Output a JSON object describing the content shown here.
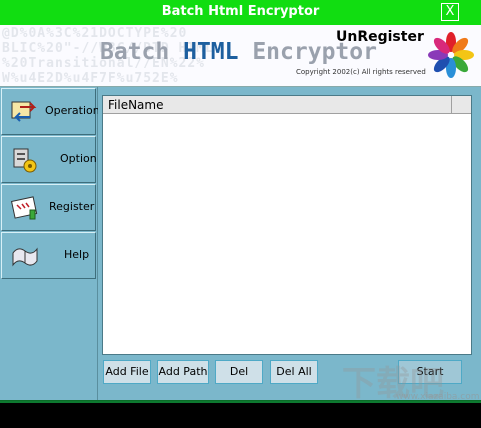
{
  "window": {
    "title": "Batch Html Encryptor",
    "close_label": "X"
  },
  "banner": {
    "watermark_lines": [
      "@D%0A%3C%21DOCTYPE%20",
      "BLIC%20\"-//W3C//DTD HTML",
      "%20Transitional//EN%22%",
      "W%u4E2D%u4F7F%u752E%"
    ],
    "brand_part1": "Batch ",
    "brand_part2": "HTML",
    "brand_part3": " Encryptor",
    "registration_status": "UnRegister",
    "copyright": "Copyright 2002(c)  All rights reserved"
  },
  "sidebar": {
    "items": [
      {
        "label": "Operation",
        "icon": "operation-icon"
      },
      {
        "label": "Option",
        "icon": "option-icon"
      },
      {
        "label": "Register",
        "icon": "register-icon"
      },
      {
        "label": "Help",
        "icon": "help-icon"
      }
    ]
  },
  "file_list": {
    "columns": [
      "FileName"
    ],
    "rows": []
  },
  "buttons": {
    "add_file": "Add File",
    "add_path": "Add Path",
    "del": "Del",
    "del_all": "Del All",
    "start": "Start"
  },
  "watermark": {
    "text": "下载吧",
    "url": "www.xiazaiba.com"
  },
  "colors": {
    "title_bar": "#11dd11",
    "panel": "#7bb7cb",
    "status_bar": "#000000",
    "brand_accent": "#1d5f9f"
  }
}
